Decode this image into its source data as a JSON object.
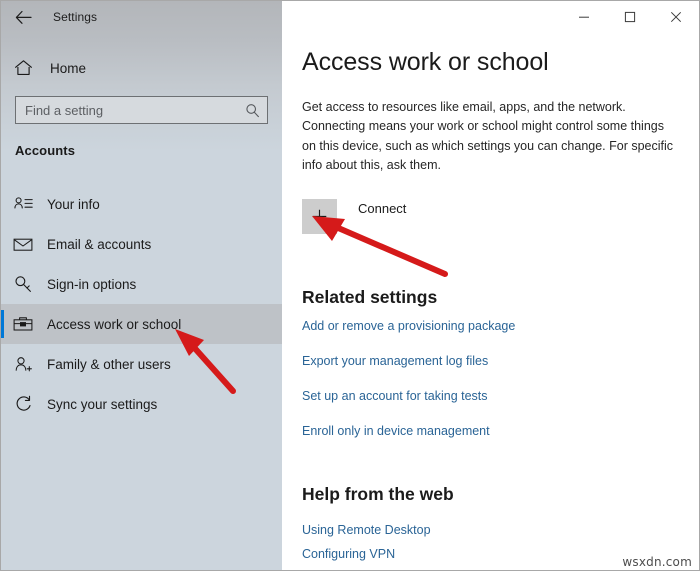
{
  "window": {
    "app_title": "Settings",
    "back_icon": "back-arrow-icon",
    "controls": {
      "minimize": "─",
      "maximize": "□",
      "close": "✕"
    }
  },
  "sidebar": {
    "home_label": "Home",
    "home_icon": "home-icon",
    "search": {
      "placeholder": "Find a setting",
      "value": "",
      "icon": "search-icon"
    },
    "section_heading": "Accounts",
    "items": [
      {
        "label": "Your info",
        "icon": "person-list-icon",
        "selected": false
      },
      {
        "label": "Email & accounts",
        "icon": "envelope-icon",
        "selected": false
      },
      {
        "label": "Sign-in options",
        "icon": "key-icon",
        "selected": false
      },
      {
        "label": "Access work or school",
        "icon": "briefcase-icon",
        "selected": true
      },
      {
        "label": "Family & other users",
        "icon": "person-add-icon",
        "selected": false
      },
      {
        "label": "Sync your settings",
        "icon": "sync-icon",
        "selected": false
      }
    ]
  },
  "main": {
    "title": "Access work or school",
    "description": "Get access to resources like email, apps, and the network. Connecting means your work or school might control some things on this device, such as which settings you can change. For specific info about this, ask them.",
    "connect": {
      "label": "Connect",
      "icon": "plus-icon"
    },
    "related_settings": {
      "heading": "Related settings",
      "links": [
        "Add or remove a provisioning package",
        "Export your management log files",
        "Set up an account for taking tests",
        "Enroll only in device management"
      ]
    },
    "help_from_web": {
      "heading": "Help from the web",
      "links": [
        "Using Remote Desktop",
        "Configuring VPN"
      ]
    }
  },
  "annotations": {
    "watermark": "wsxdn.com",
    "arrow_color": "#d51a1a"
  },
  "theme": {
    "accent": "#0078d7",
    "link": "#2a6496",
    "sidebar_bg": "#ccd5dd",
    "selected_bg": "#bec2c7"
  }
}
